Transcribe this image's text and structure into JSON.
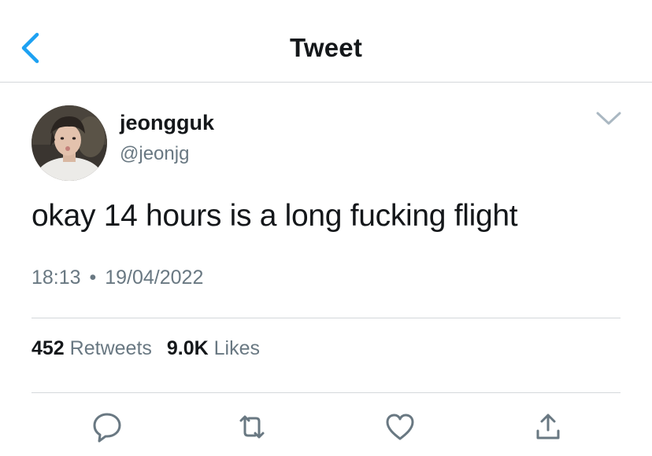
{
  "header": {
    "title": "Tweet",
    "back_icon": "chevron-left-icon"
  },
  "colors": {
    "accent": "#1da1f2",
    "secondary_text": "#697882",
    "divider": "#d4d8db"
  },
  "tweet": {
    "display_name": "jeongguk",
    "handle": "@jeonjg",
    "text": "okay 14 hours is a long fucking flight",
    "time": "18:13",
    "separator": "•",
    "date": "19/04/2022",
    "retweets_count": "452",
    "retweets_label": "Retweets",
    "likes_count": "9.0K",
    "likes_label": "Likes"
  },
  "actions": [
    "reply-icon",
    "retweet-icon",
    "like-icon",
    "share-icon"
  ]
}
